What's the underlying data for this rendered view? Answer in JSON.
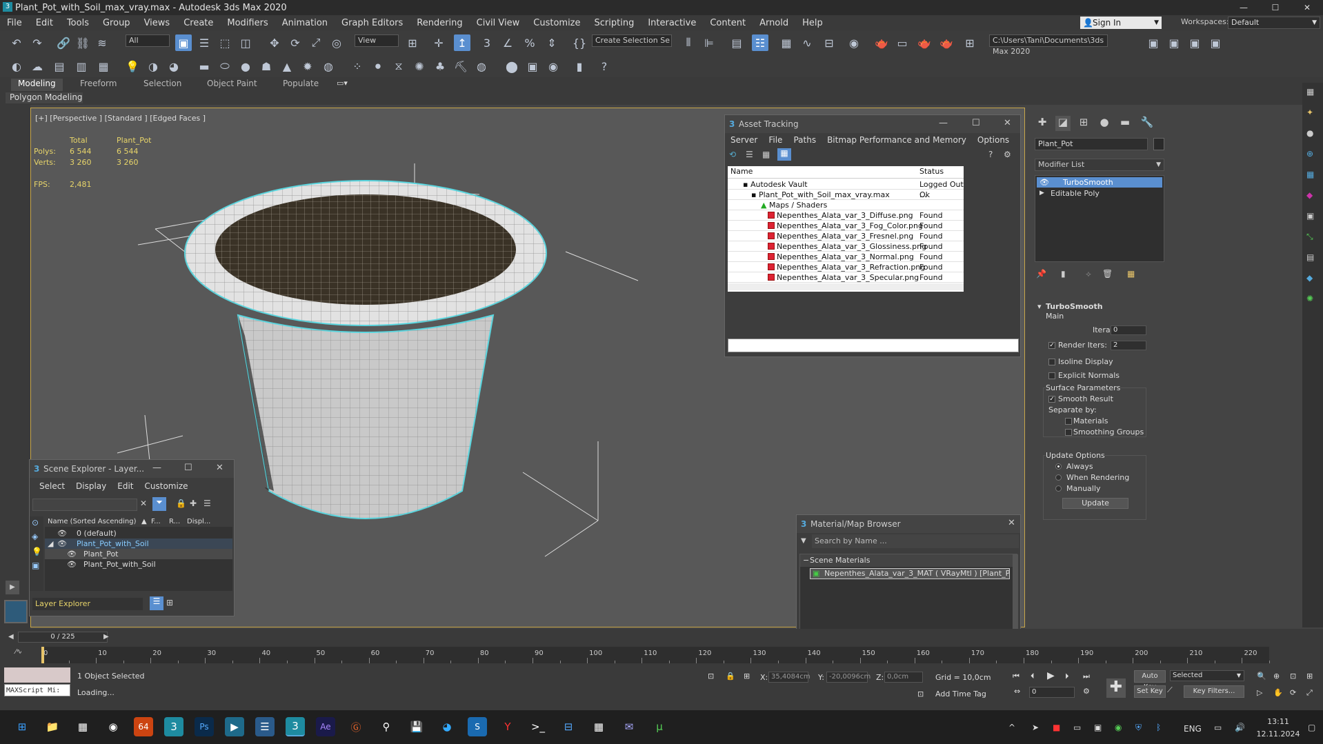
{
  "window": {
    "title": "Plant_Pot_with_Soil_max_vray.max - Autodesk 3ds Max 2020",
    "min": "—",
    "max": "☐",
    "close": "✕"
  },
  "menu": [
    "File",
    "Edit",
    "Tools",
    "Group",
    "Views",
    "Create",
    "Modifiers",
    "Animation",
    "Graph Editors",
    "Rendering",
    "Civil View",
    "Customize",
    "Scripting",
    "Interactive",
    "Content",
    "Arnold",
    "Help"
  ],
  "account": {
    "signin": "Sign In",
    "workspaces_label": "Workspaces:",
    "workspace": "Default"
  },
  "toolbar": {
    "filter": "All",
    "view": "View",
    "selection_set": "Create Selection Se",
    "path": "C:\\Users\\Tani\\Documents\\3ds Max 2020"
  },
  "ribbon": {
    "tabs": [
      "Modeling",
      "Freeform",
      "Selection",
      "Object Paint",
      "Populate"
    ],
    "sub": "Polygon Modeling"
  },
  "viewport": {
    "label": "[+] [Perspective ] [Standard ] [Edged Faces ]",
    "stats_head_total": "Total",
    "stats_head_obj": "Plant_Pot",
    "polys_label": "Polys:",
    "polys_total": "6 544",
    "polys_obj": "6 544",
    "verts_label": "Verts:",
    "verts_total": "3 260",
    "verts_obj": "3 260",
    "fps_label": "FPS:",
    "fps": "2,481"
  },
  "asset_tracking": {
    "title": "Asset Tracking",
    "menu": [
      "Server",
      "File",
      "Paths",
      "Bitmap Performance and Memory",
      "Options"
    ],
    "col_name": "Name",
    "col_status": "Status",
    "rows": [
      {
        "name": "Autodesk Vault",
        "status": "Logged Out ..."
      },
      {
        "name": "Plant_Pot_with_Soil_max_vray.max",
        "status": "Ok"
      },
      {
        "name": "Maps / Shaders",
        "status": ""
      },
      {
        "name": "Nepenthes_Alata_var_3_Diffuse.png",
        "status": "Found"
      },
      {
        "name": "Nepenthes_Alata_var_3_Fog_Color.png",
        "status": "Found"
      },
      {
        "name": "Nepenthes_Alata_var_3_Fresnel.png",
        "status": "Found"
      },
      {
        "name": "Nepenthes_Alata_var_3_Glossiness.png",
        "status": "Found"
      },
      {
        "name": "Nepenthes_Alata_var_3_Normal.png",
        "status": "Found"
      },
      {
        "name": "Nepenthes_Alata_var_3_Refraction.png",
        "status": "Found"
      },
      {
        "name": "Nepenthes_Alata_var_3_Specular.png",
        "status": "Found"
      }
    ]
  },
  "material_browser": {
    "title": "Material/Map Browser",
    "search_placeholder": "Search by Name ...",
    "section": "Scene Materials",
    "item": "Nepenthes_Alata_var_3_MAT  ( VRayMtl )  [Plant_P..."
  },
  "scene_explorer": {
    "title": "Scene Explorer - Layer...",
    "menu": [
      "Select",
      "Display",
      "Edit",
      "Customize"
    ],
    "col_name": "Name (Sorted Ascending)",
    "col_f": "F...",
    "col_r": "R...",
    "col_d": "Displ...",
    "rows": [
      "0 (default)",
      "Plant_Pot_with_Soil",
      "Plant_Pot",
      "Plant_Pot_with_Soil"
    ],
    "footer": "Layer Explorer"
  },
  "command_panel": {
    "object_name": "Plant_Pot",
    "modifier_list": "Modifier List",
    "stack": [
      "TurboSmooth",
      "Editable Poly"
    ],
    "rollout_title": "TurboSmooth",
    "main": "Main",
    "iterations_label": "Iterations:",
    "iterations": "0",
    "render_iters_label": "Render Iters:",
    "render_iters": "2",
    "isoline": "Isoline Display",
    "explicit": "Explicit Normals",
    "surface": "Surface Parameters",
    "smooth_result": "Smooth Result",
    "separate_by": "Separate by:",
    "materials": "Materials",
    "smoothing_groups": "Smoothing Groups",
    "update_options": "Update Options",
    "always": "Always",
    "when_rendering": "When Rendering",
    "manually": "Manually",
    "update_btn": "Update"
  },
  "timeline": {
    "frame": "0 / 225",
    "ticks": [
      "0",
      "10",
      "20",
      "30",
      "40",
      "50",
      "60",
      "70",
      "80",
      "90",
      "100",
      "110",
      "120",
      "130",
      "140",
      "150",
      "160",
      "170",
      "180",
      "190",
      "200",
      "210",
      "220"
    ]
  },
  "status": {
    "maxscript": "MAXScript Mi:",
    "selected": "1 Object Selected",
    "loading": "Loading...",
    "x_label": "X:",
    "x": "35,4084cm",
    "y_label": "Y:",
    "y": "-20,0096cm",
    "z_label": "Z:",
    "z": "0,0cm",
    "grid": "Grid = 10,0cm",
    "add_time_tag": "Add Time Tag",
    "auto_key": "Auto Key",
    "set_key": "Set Key",
    "selected_dd": "Selected",
    "key_filters": "Key Filters...",
    "frame_field": "0"
  },
  "taskbar": {
    "lang": "ENG",
    "time": "13:11",
    "date": "12.11.2024",
    "badge": "64"
  }
}
